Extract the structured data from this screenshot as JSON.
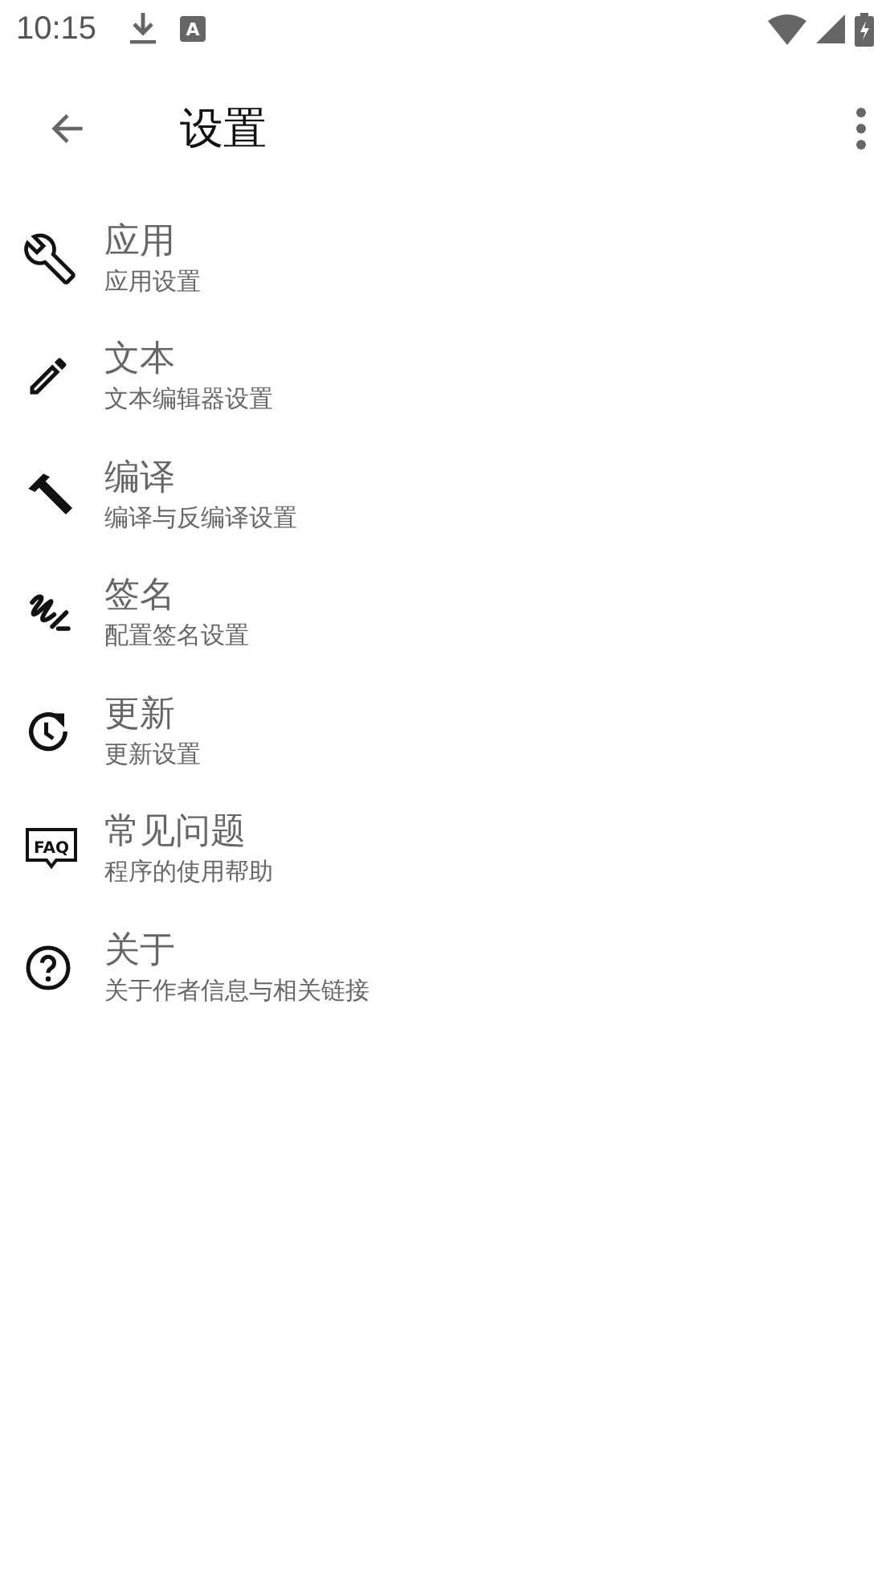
{
  "status_bar": {
    "time": "10:15",
    "badge": "A"
  },
  "toolbar": {
    "title": "设置"
  },
  "items": [
    {
      "kind": "wrench",
      "title": "应用",
      "subtitle": "应用设置"
    },
    {
      "kind": "pencil",
      "title": "文本",
      "subtitle": "文本编辑器设置"
    },
    {
      "kind": "hammer",
      "title": "编译",
      "subtitle": "编译与反编译设置"
    },
    {
      "kind": "signature",
      "title": "签名",
      "subtitle": "配置签名设置"
    },
    {
      "kind": "update",
      "title": "更新",
      "subtitle": "更新设置"
    },
    {
      "kind": "faq",
      "icon_text": "FAQ",
      "title": "常见问题",
      "subtitle": "程序的使用帮助"
    },
    {
      "kind": "help",
      "title": "关于",
      "subtitle": "关于作者信息与相关链接"
    }
  ]
}
